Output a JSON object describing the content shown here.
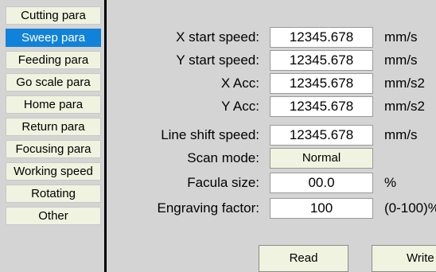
{
  "sidebar": {
    "items": [
      {
        "label": "Cutting para"
      },
      {
        "label": "Sweep para",
        "active": true
      },
      {
        "label": "Feeding para"
      },
      {
        "label": "Go scale para"
      },
      {
        "label": "Home para"
      },
      {
        "label": "Return para"
      },
      {
        "label": "Focusing para"
      },
      {
        "label": "Working speed"
      },
      {
        "label": "Rotating"
      },
      {
        "label": "Other"
      }
    ]
  },
  "form": {
    "rows": [
      {
        "label": "X start speed:",
        "value": "12345.678",
        "unit": "mm/s"
      },
      {
        "label": "Y start speed:",
        "value": "12345.678",
        "unit": "mm/s"
      },
      {
        "label": "X Acc:",
        "value": "12345.678",
        "unit": "mm/s2"
      },
      {
        "label": "Y Acc:",
        "value": "12345.678",
        "unit": "mm/s2"
      },
      {
        "label": "Line shift speed:",
        "value": "12345.678",
        "unit": "mm/s"
      },
      {
        "label": "Scan mode:",
        "value": "Normal",
        "unit": ""
      },
      {
        "label": "Facula size:",
        "value": "00.0",
        "unit": "%"
      },
      {
        "label": "Engraving factor:",
        "value": "100",
        "unit": "(0-100)%"
      }
    ]
  },
  "actions": {
    "read_label": "Read",
    "write_label": "Write"
  },
  "colors": {
    "background": "#d4d4d4",
    "item_bg": "#f0f3df",
    "active_bg": "#1182d9"
  }
}
